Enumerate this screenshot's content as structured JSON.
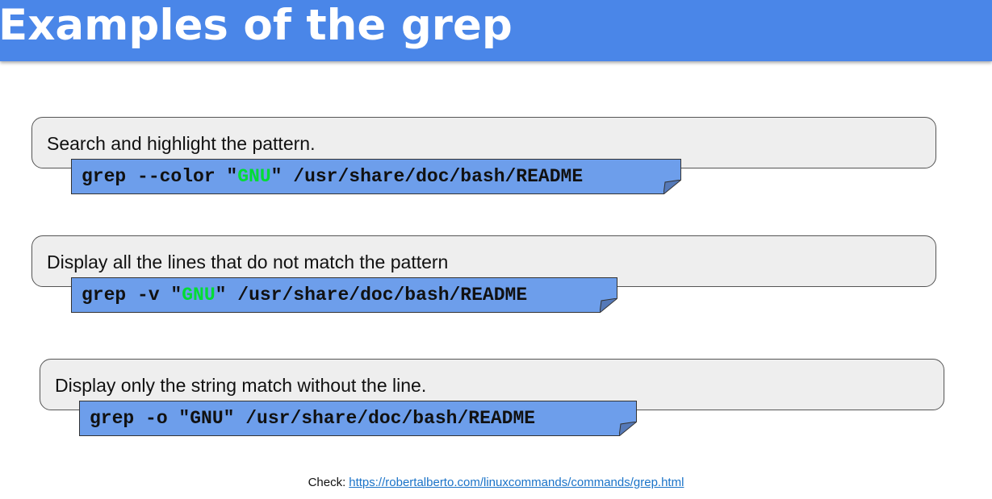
{
  "title": "Examples of the grep",
  "examples": [
    {
      "description": "Search and highlight the pattern.",
      "cmd_pre": "grep --color \"",
      "cmd_pattern": "GNU",
      "cmd_post": "\" /usr/share/doc/bash/README"
    },
    {
      "description": "Display all the lines that do not match the pattern",
      "cmd_pre": "grep -v \"",
      "cmd_pattern": "GNU",
      "cmd_post": "\" /usr/share/doc/bash/README"
    },
    {
      "description": "Display only the string match without the line.",
      "cmd": "grep -o \"GNU\" /usr/share/doc/bash/README"
    }
  ],
  "footer": {
    "label": "Check:",
    "link": "https://robertalberto.com/linuxcommands/commands/grep.html"
  },
  "colors": {
    "header": "#4a86e8",
    "command_box": "#6d9eeb",
    "description_box": "#eeeeee",
    "highlight": "#00dd33",
    "link": "#1a73c8"
  }
}
